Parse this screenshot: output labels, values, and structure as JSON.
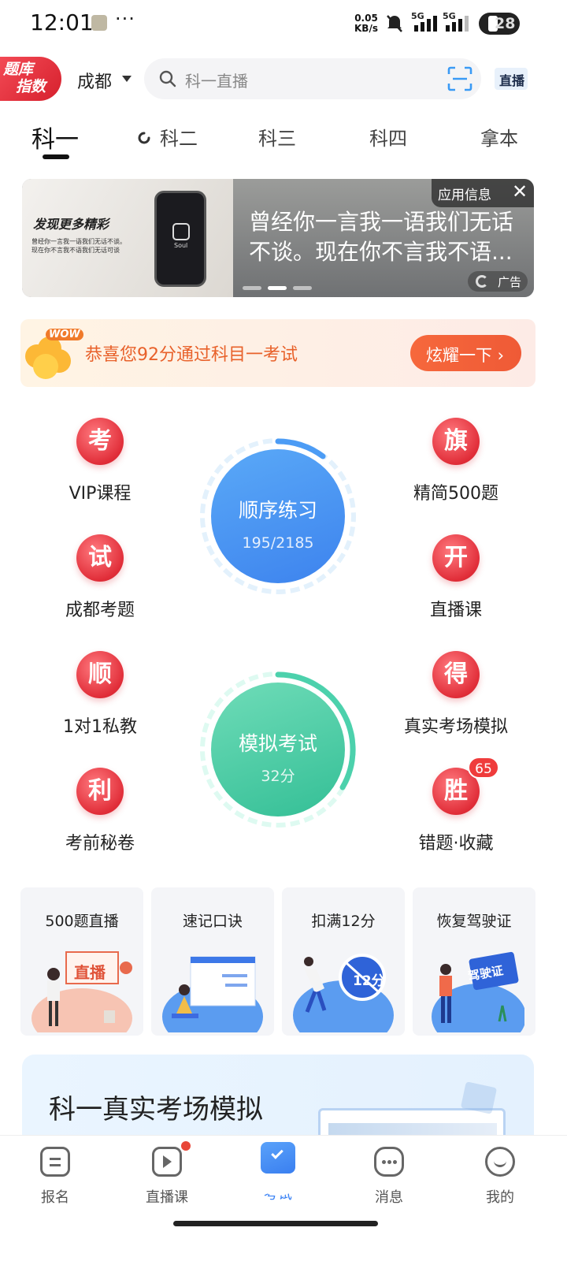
{
  "status_bar": {
    "time": "12:01",
    "dots": "···",
    "net_speed": "0.05",
    "net_unit": "KB/s",
    "signal1": "5G",
    "signal2": "5G",
    "battery": "28"
  },
  "header": {
    "logo_line1": "题库",
    "logo_line2": "指数",
    "city": "成都",
    "search_placeholder": "科一直播",
    "live_label": "直播"
  },
  "tabs": [
    {
      "label": "科一",
      "active": true
    },
    {
      "label": "科二"
    },
    {
      "label": "科三"
    },
    {
      "label": "科四"
    },
    {
      "label": "拿本"
    }
  ],
  "banner": {
    "left_title": "发现更多精彩",
    "left_sub1": "曾经你一言我一语我们无话不谈。",
    "left_sub2": "现在你不言我不语我们无话可谈",
    "app_name": "Soul",
    "headline_line1": "曾经你一言我一语我们无话",
    "headline_line2": "不谈。现在你不言我不语...",
    "ad_info": "应用信息",
    "ad_close": "✕",
    "ad_tag": "广告",
    "active_dot": 2
  },
  "congrats": {
    "wow": "WOW",
    "text": "恭喜您92分通过科目一考试",
    "button": "炫耀一下 ›"
  },
  "grid_left": [
    {
      "icon": "考",
      "label": "VIP课程"
    },
    {
      "icon": "试",
      "label": "成都考题"
    },
    {
      "icon": "顺",
      "label": "1对1私教"
    },
    {
      "icon": "利",
      "label": "考前秘卷"
    }
  ],
  "grid_right": [
    {
      "icon": "旗",
      "label": "精简500题"
    },
    {
      "icon": "开",
      "label": "直播课"
    },
    {
      "icon": "得",
      "label": "真实考场模拟"
    },
    {
      "icon": "胜",
      "label": "错题·收藏",
      "badge": "65"
    }
  ],
  "practice": {
    "title": "顺序练习",
    "progress": "195/2185"
  },
  "mock_exam": {
    "title": "模拟考试",
    "score": "32分"
  },
  "features": [
    {
      "title": "500题直播",
      "art_text": "直播"
    },
    {
      "title": "速记口诀"
    },
    {
      "title": "扣满12分",
      "art_text": "12分"
    },
    {
      "title": "恢复驾驶证",
      "art_text": "驾驶证"
    }
  ],
  "exam_card": {
    "title": "科一真实考场模拟"
  },
  "bottom_nav": [
    {
      "label": "报名"
    },
    {
      "label": "直播课",
      "has_dot": true
    },
    {
      "label": "考试",
      "active": true
    },
    {
      "label": "消息"
    },
    {
      "label": "我的"
    }
  ],
  "colors": {
    "accent": "#3a82f5",
    "brand_red": "#e12e39",
    "practice_blue": "#4f95f3",
    "mock_green": "#3fcca3",
    "orange": "#e8612a"
  }
}
